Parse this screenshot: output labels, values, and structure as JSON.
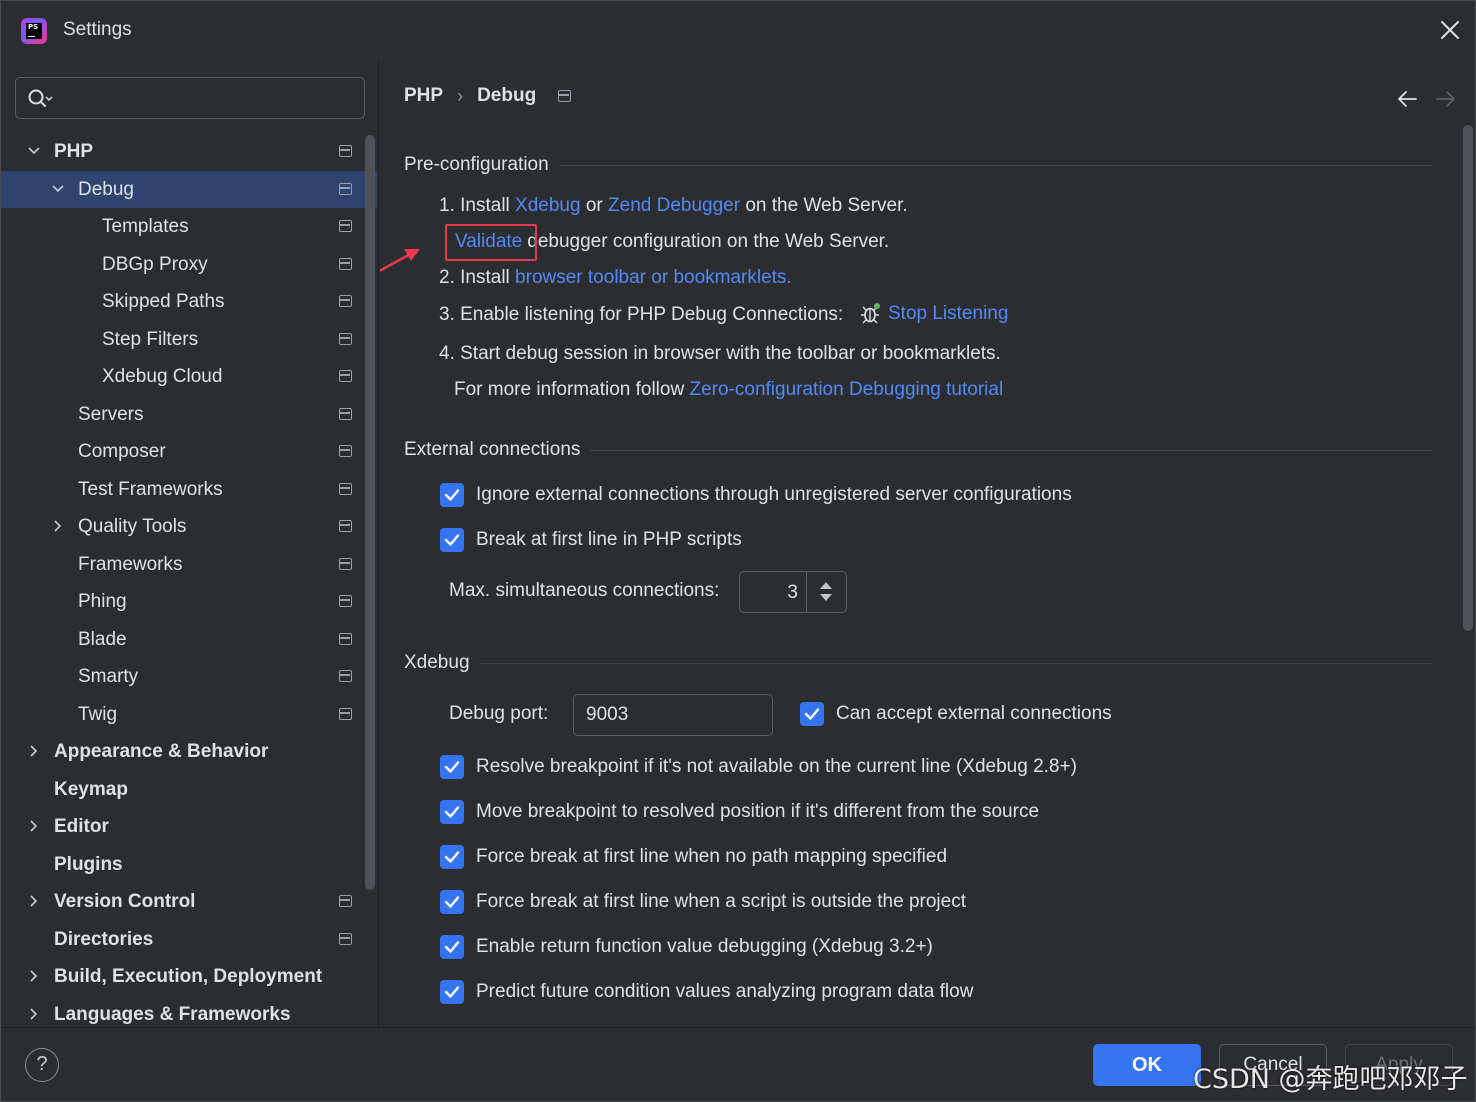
{
  "window": {
    "title": "Settings"
  },
  "sidebar": {
    "search_placeholder": "",
    "items": [
      {
        "label": "PHP",
        "bold": true,
        "level": 0,
        "expander": "down",
        "project_icon": true
      },
      {
        "label": "Debug",
        "bold": false,
        "level": 1,
        "expander": "down",
        "project_icon": true,
        "selected": true
      },
      {
        "label": "Templates",
        "bold": false,
        "level": 2,
        "expander": "none",
        "project_icon": true
      },
      {
        "label": "DBGp Proxy",
        "bold": false,
        "level": 2,
        "expander": "none",
        "project_icon": true
      },
      {
        "label": "Skipped Paths",
        "bold": false,
        "level": 2,
        "expander": "none",
        "project_icon": true
      },
      {
        "label": "Step Filters",
        "bold": false,
        "level": 2,
        "expander": "none",
        "project_icon": true
      },
      {
        "label": "Xdebug Cloud",
        "bold": false,
        "level": 2,
        "expander": "none",
        "project_icon": true
      },
      {
        "label": "Servers",
        "bold": false,
        "level": 1,
        "expander": "none",
        "project_icon": true
      },
      {
        "label": "Composer",
        "bold": false,
        "level": 1,
        "expander": "none",
        "project_icon": true
      },
      {
        "label": "Test Frameworks",
        "bold": false,
        "level": 1,
        "expander": "none",
        "project_icon": true
      },
      {
        "label": "Quality Tools",
        "bold": false,
        "level": 1,
        "expander": "right",
        "project_icon": true
      },
      {
        "label": "Frameworks",
        "bold": false,
        "level": 1,
        "expander": "none",
        "project_icon": true
      },
      {
        "label": "Phing",
        "bold": false,
        "level": 1,
        "expander": "none",
        "project_icon": true
      },
      {
        "label": "Blade",
        "bold": false,
        "level": 1,
        "expander": "none",
        "project_icon": true
      },
      {
        "label": "Smarty",
        "bold": false,
        "level": 1,
        "expander": "none",
        "project_icon": true
      },
      {
        "label": "Twig",
        "bold": false,
        "level": 1,
        "expander": "none",
        "project_icon": true
      },
      {
        "label": "Appearance & Behavior",
        "bold": true,
        "level": 0,
        "expander": "right",
        "project_icon": false
      },
      {
        "label": "Keymap",
        "bold": true,
        "level": 0,
        "expander": "none",
        "project_icon": false
      },
      {
        "label": "Editor",
        "bold": true,
        "level": 0,
        "expander": "right",
        "project_icon": false
      },
      {
        "label": "Plugins",
        "bold": true,
        "level": 0,
        "expander": "none",
        "project_icon": false
      },
      {
        "label": "Version Control",
        "bold": true,
        "level": 0,
        "expander": "right",
        "project_icon": true
      },
      {
        "label": "Directories",
        "bold": true,
        "level": 0,
        "expander": "none",
        "project_icon": true
      },
      {
        "label": "Build, Execution, Deployment",
        "bold": true,
        "level": 0,
        "expander": "right",
        "project_icon": false
      },
      {
        "label": "Languages & Frameworks",
        "bold": true,
        "level": 0,
        "expander": "right",
        "project_icon": false
      }
    ]
  },
  "breadcrumb": {
    "parent": "PHP",
    "separator": "›",
    "current": "Debug"
  },
  "preconfig": {
    "title": "Pre-configuration",
    "step1_prefix": "1. Install",
    "step1_link1": "Xdebug",
    "step1_or": "or",
    "step1_link2": "Zend Debugger",
    "step1_suffix": "on the Web Server.",
    "validate_link": "Validate",
    "validate_suffix": "debugger configuration on the Web Server.",
    "step2_prefix": "2. Install",
    "step2_link": "browser toolbar or bookmarklets.",
    "step3_prefix": "3. Enable listening for PHP Debug Connections:",
    "step3_link": "Stop Listening",
    "step4": "4. Start debug session in browser with the toolbar or bookmarklets.",
    "info_prefix": "For more information follow",
    "info_link": "Zero-configuration Debugging tutorial"
  },
  "external": {
    "title": "External connections",
    "ignore_label": "Ignore external connections through unregistered server configurations",
    "ignore_checked": true,
    "break_label": "Break at first line in PHP scripts",
    "break_checked": true,
    "max_label": "Max. simultaneous connections:",
    "max_value": "3"
  },
  "xdebug": {
    "title": "Xdebug",
    "port_label": "Debug port:",
    "port_value": "9003",
    "accept_label": "Can accept external connections",
    "accept_checked": true,
    "options": [
      {
        "label": "Resolve breakpoint if it's not available on the current line (Xdebug 2.8+)",
        "checked": true
      },
      {
        "label": "Move breakpoint to resolved position if it's different from the source",
        "checked": true
      },
      {
        "label": "Force break at first line when no path mapping specified",
        "checked": true
      },
      {
        "label": "Force break at first line when a script is outside the project",
        "checked": true
      },
      {
        "label": "Enable return function value debugging (Xdebug 3.2+)",
        "checked": true
      },
      {
        "label": "Predict future condition values analyzing program data flow",
        "checked": true
      }
    ]
  },
  "footer": {
    "help": "?",
    "ok": "OK",
    "cancel": "Cancel",
    "apply": "Apply"
  },
  "watermark": "CSDN @奔跑吧邓邓子",
  "colors": {
    "accent": "#3574f0",
    "link": "#548af7",
    "selection": "#2e436e",
    "highlight_box": "#e8394d",
    "background": "#2b2d30"
  }
}
